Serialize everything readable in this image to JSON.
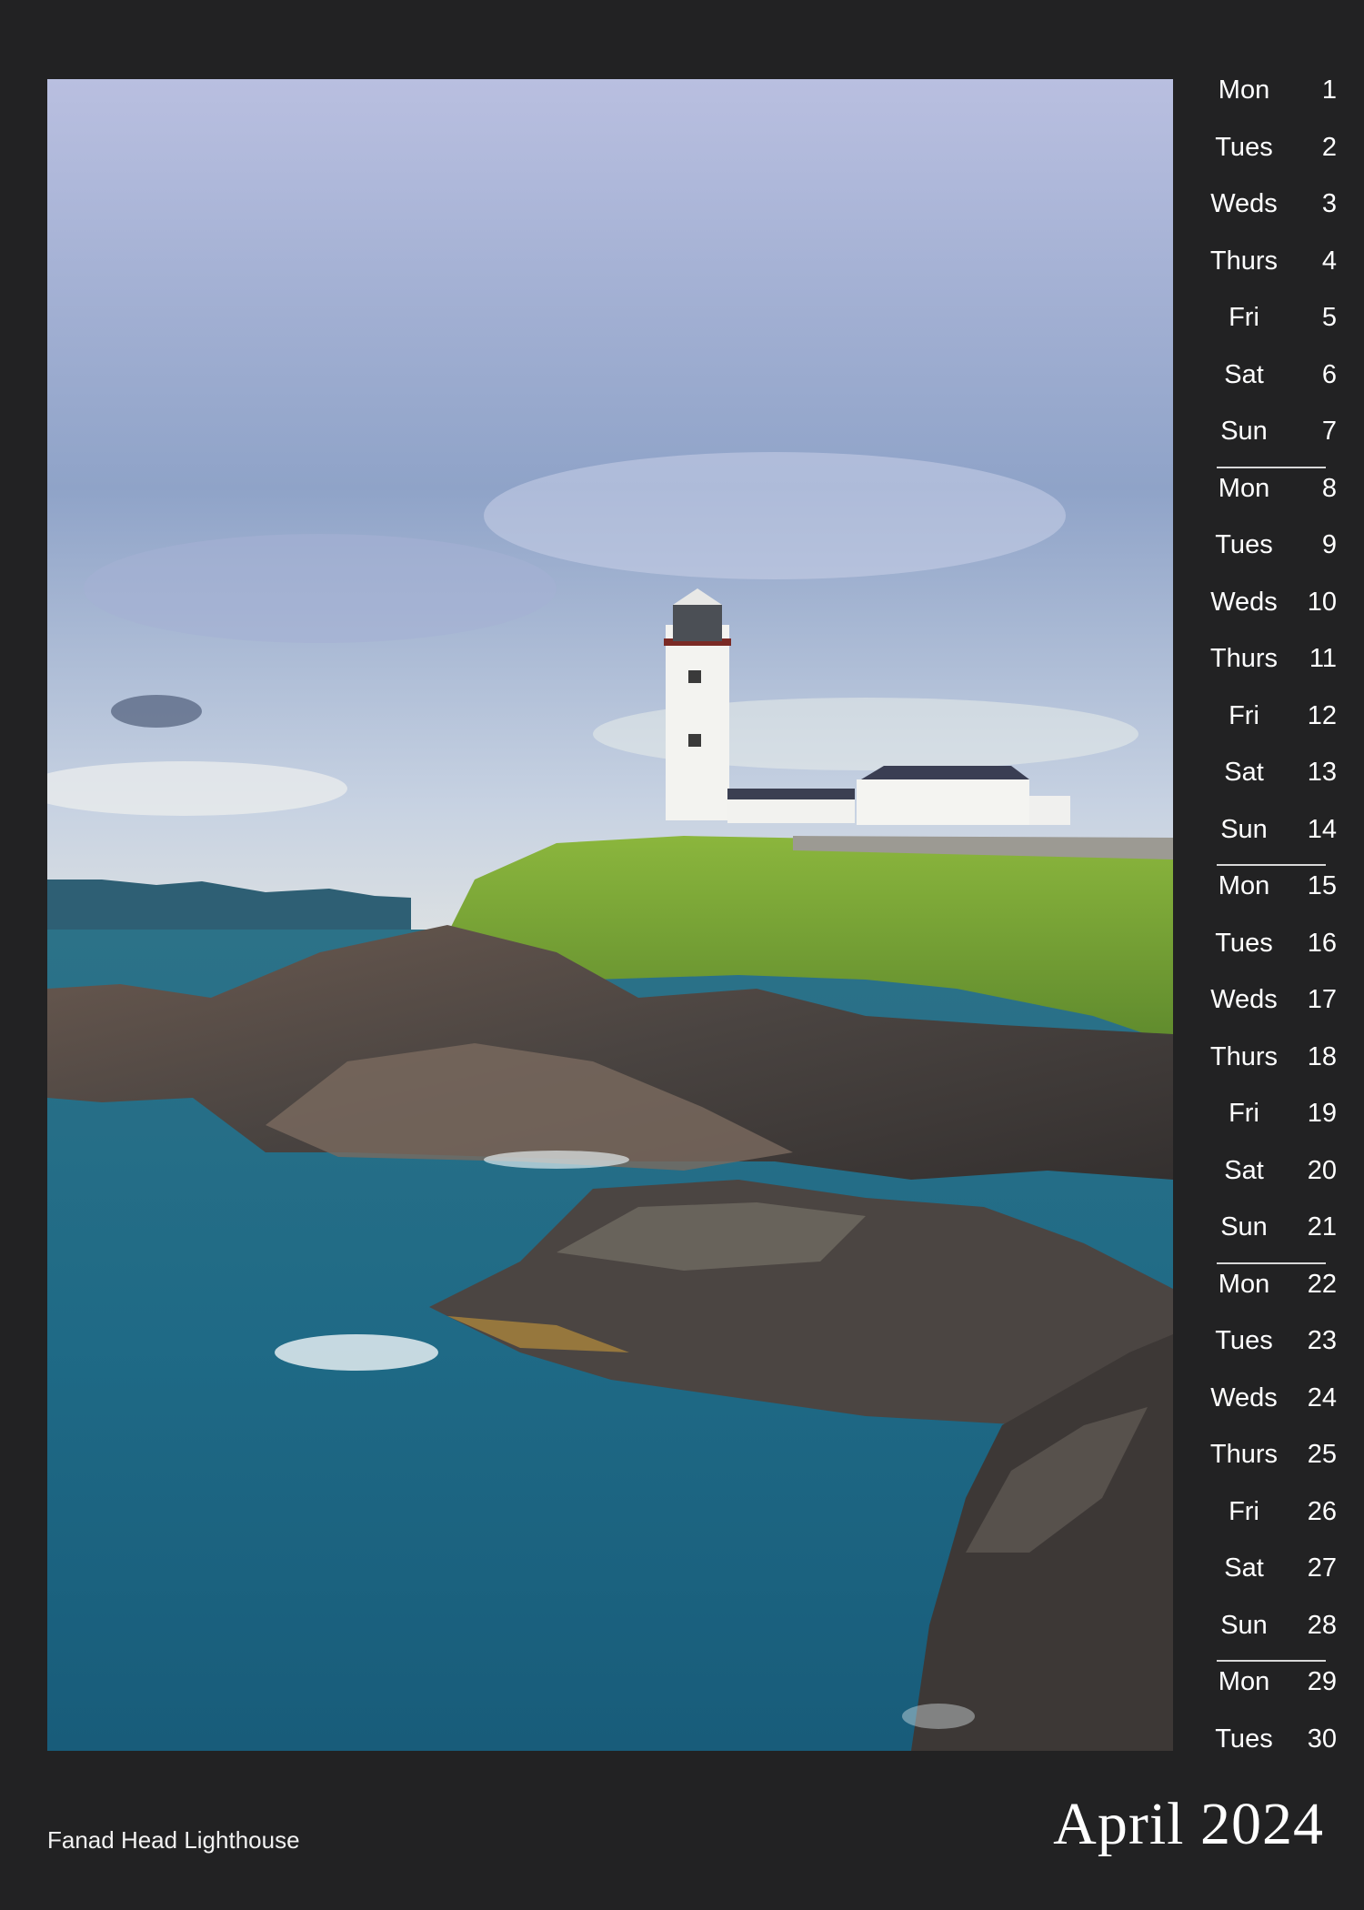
{
  "calendar": {
    "month_title": "April 2024",
    "caption": "Fanad Head Lighthouse",
    "days": [
      {
        "name": "Mon",
        "num": "1"
      },
      {
        "name": "Tues",
        "num": "2"
      },
      {
        "name": "Weds",
        "num": "3"
      },
      {
        "name": "Thurs",
        "num": "4"
      },
      {
        "name": "Fri",
        "num": "5"
      },
      {
        "name": "Sat",
        "num": "6"
      },
      {
        "name": "Sun",
        "num": "7"
      },
      {
        "name": "Mon",
        "num": "8"
      },
      {
        "name": "Tues",
        "num": "9"
      },
      {
        "name": "Weds",
        "num": "10"
      },
      {
        "name": "Thurs",
        "num": "11"
      },
      {
        "name": "Fri",
        "num": "12"
      },
      {
        "name": "Sat",
        "num": "13"
      },
      {
        "name": "Sun",
        "num": "14"
      },
      {
        "name": "Mon",
        "num": "15"
      },
      {
        "name": "Tues",
        "num": "16"
      },
      {
        "name": "Weds",
        "num": "17"
      },
      {
        "name": "Thurs",
        "num": "18"
      },
      {
        "name": "Fri",
        "num": "19"
      },
      {
        "name": "Sat",
        "num": "20"
      },
      {
        "name": "Sun",
        "num": "21"
      },
      {
        "name": "Mon",
        "num": "22"
      },
      {
        "name": "Tues",
        "num": "23"
      },
      {
        "name": "Weds",
        "num": "24"
      },
      {
        "name": "Thurs",
        "num": "25"
      },
      {
        "name": "Fri",
        "num": "26"
      },
      {
        "name": "Sat",
        "num": "27"
      },
      {
        "name": "Sun",
        "num": "28"
      },
      {
        "name": "Mon",
        "num": "29"
      },
      {
        "name": "Tues",
        "num": "30"
      }
    ]
  },
  "colors": {
    "page_background": "#222223",
    "text": "#ffffff",
    "separator": "#d8d8d8"
  }
}
